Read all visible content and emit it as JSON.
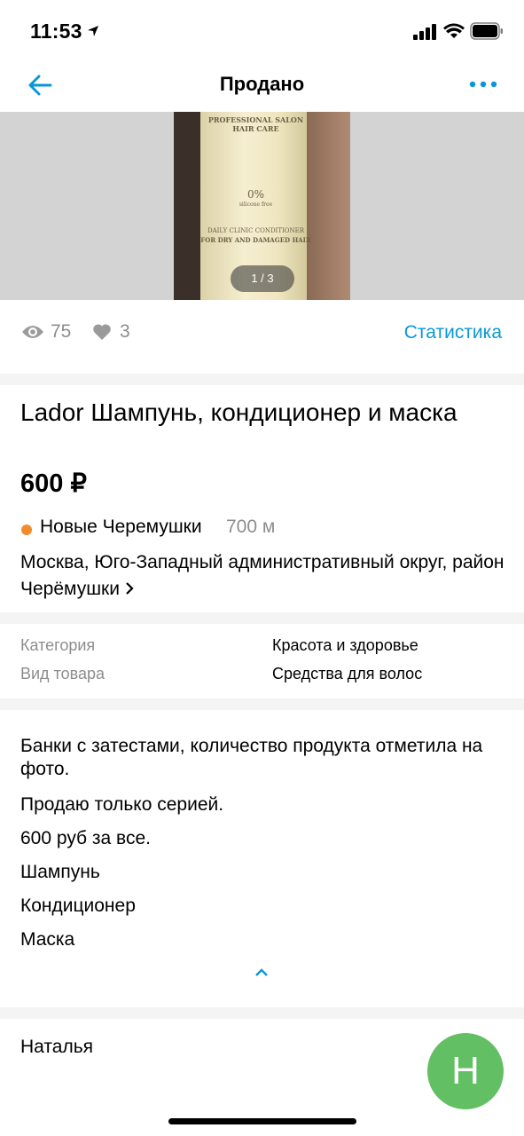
{
  "status_bar": {
    "time": "11:53"
  },
  "nav": {
    "title": "Продано"
  },
  "gallery": {
    "pager": "1 / 3",
    "photo_text": {
      "top": "PROFESSIONAL SALON HAIR CARE",
      "badge": "0%",
      "badge_sub": "silicone free",
      "line1": "DAILY CLINIC CONDITIONER",
      "line2": "FOR DRY AND DAMAGED HAIR"
    }
  },
  "stats": {
    "views": "75",
    "likes": "3",
    "link": "Статистика"
  },
  "listing": {
    "title": "Lador Шампунь, кондиционер и маска",
    "price": "600 ₽",
    "metro": "Новые Черемушки",
    "distance": "700 м",
    "address": "Москва, Юго-Западный административный округ, район Черёмушки"
  },
  "params": [
    {
      "label": "Категория",
      "value": "Красота и здоровье"
    },
    {
      "label": "Вид товара",
      "value": "Средства для волос"
    }
  ],
  "description": [
    "Банки с затестами, количество продукта отметила на фото.",
    "Продаю только серией.",
    "600 руб за все.",
    "Шампунь",
    "Кондиционер",
    "Маска"
  ],
  "seller": {
    "name": "Наталья",
    "initial": "Н"
  },
  "colors": {
    "accent": "#0a97d9",
    "metro": "#f28b2c",
    "avatar": "#62bf64"
  }
}
